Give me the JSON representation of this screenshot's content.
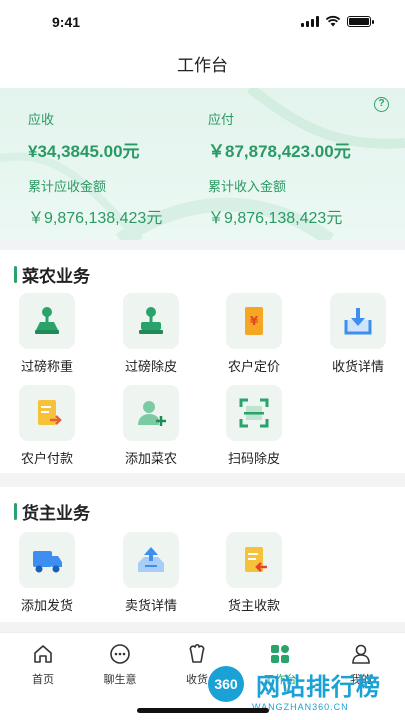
{
  "status_bar": {
    "time": "9:41"
  },
  "nav": {
    "title": "工作台"
  },
  "summary": {
    "help_glyph": "?",
    "receivable_label": "应收",
    "receivable_value": "¥34,3845.00元",
    "payable_label": "应付",
    "payable_value": "￥87,878,423.00元",
    "cumulative_receivable_label": "累计应收金额",
    "cumulative_receivable_value": "￥9,876,138,423元",
    "cumulative_income_label": "累计收入金额",
    "cumulative_income_value": "￥9,876,138,423元"
  },
  "farmer_section": {
    "title": "菜农业务",
    "items": [
      {
        "label": "过磅称重",
        "icon": "scale-weigh-icon"
      },
      {
        "label": "过磅除皮",
        "icon": "scale-tare-icon"
      },
      {
        "label": "农户定价",
        "icon": "price-tag-icon"
      },
      {
        "label": "收货详情",
        "icon": "receive-download-icon"
      },
      {
        "label": "农户付款",
        "icon": "payment-doc-icon"
      },
      {
        "label": "添加菜农",
        "icon": "add-user-icon"
      },
      {
        "label": "扫码除皮",
        "icon": "scan-code-icon"
      }
    ]
  },
  "shipper_section": {
    "title": "货主业务",
    "items": [
      {
        "label": "添加发货",
        "icon": "truck-icon"
      },
      {
        "label": "卖货详情",
        "icon": "upload-tray-icon"
      },
      {
        "label": "货主收款",
        "icon": "collect-doc-icon"
      }
    ]
  },
  "tabbar": {
    "items": [
      {
        "label": "首页",
        "icon": "home-icon"
      },
      {
        "label": "聊生意",
        "icon": "chat-icon"
      },
      {
        "label": "收货",
        "icon": "produce-icon"
      },
      {
        "label": "工作台",
        "icon": "workbench-icon"
      },
      {
        "label": "我的",
        "icon": "user-icon"
      }
    ]
  },
  "watermark": {
    "badge": "360",
    "text": "网站排行榜",
    "url": "WANGZHAN360.CN"
  },
  "colors": {
    "accent": "#2aa36a",
    "orange": "#f5a623",
    "blue": "#3d8ef0",
    "watermark": "#1aa1d6"
  }
}
